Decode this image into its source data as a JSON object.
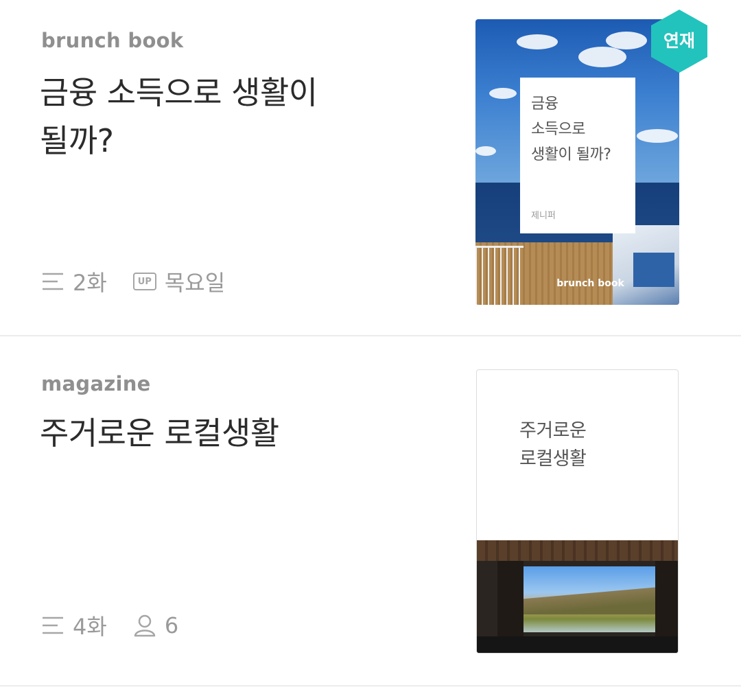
{
  "items": [
    {
      "kind": "brunch book",
      "title_line1": "금융 소득으로 생활이",
      "title_line2": "될까?",
      "meta": {
        "episodes": "2화",
        "up_badge": "UP",
        "day": "목요일"
      },
      "cover": {
        "title_line1": "금융",
        "title_line2": "소득으로",
        "title_line3": "생활이 될까?",
        "author": "제니퍼",
        "label": "brunch book",
        "badge": "연재"
      }
    },
    {
      "kind": "magazine",
      "title": "주거로운 로컬생활",
      "meta": {
        "episodes": "4화",
        "subscribers": "6"
      },
      "cover": {
        "title_line1": "주거로운",
        "title_line2": "로컬생활"
      }
    }
  ],
  "icons": {
    "list": "list-icon",
    "up": "up-badge-icon",
    "person": "person-icon"
  },
  "colors": {
    "badge_teal": "#22c3bc",
    "meta_gray": "#9a9a9a",
    "kind_gray": "#8f8f8f",
    "title_dark": "#2b2b2b"
  }
}
